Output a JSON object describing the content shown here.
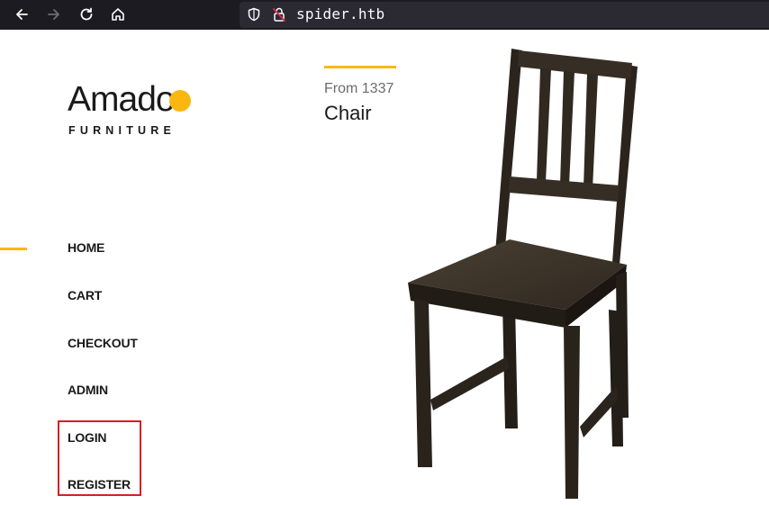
{
  "browser": {
    "url": "spider.htb",
    "icons": [
      "back-arrow-icon",
      "forward-arrow-icon",
      "reload-icon",
      "home-icon",
      "shield-icon",
      "insecure-lock-icon"
    ]
  },
  "brand": {
    "name": "Amado",
    "tagline": "FURNITURE",
    "accent_color": "#fbb710"
  },
  "nav": {
    "items": [
      {
        "label": "HOME",
        "active": true
      },
      {
        "label": "CART"
      },
      {
        "label": "CHECKOUT"
      },
      {
        "label": "ADMIN"
      },
      {
        "label": "LOGIN"
      },
      {
        "label": "REGISTER"
      }
    ]
  },
  "annotation": {
    "highlight_color": "#d81e24"
  },
  "product": {
    "price": "From 1337",
    "name": "Chair"
  }
}
